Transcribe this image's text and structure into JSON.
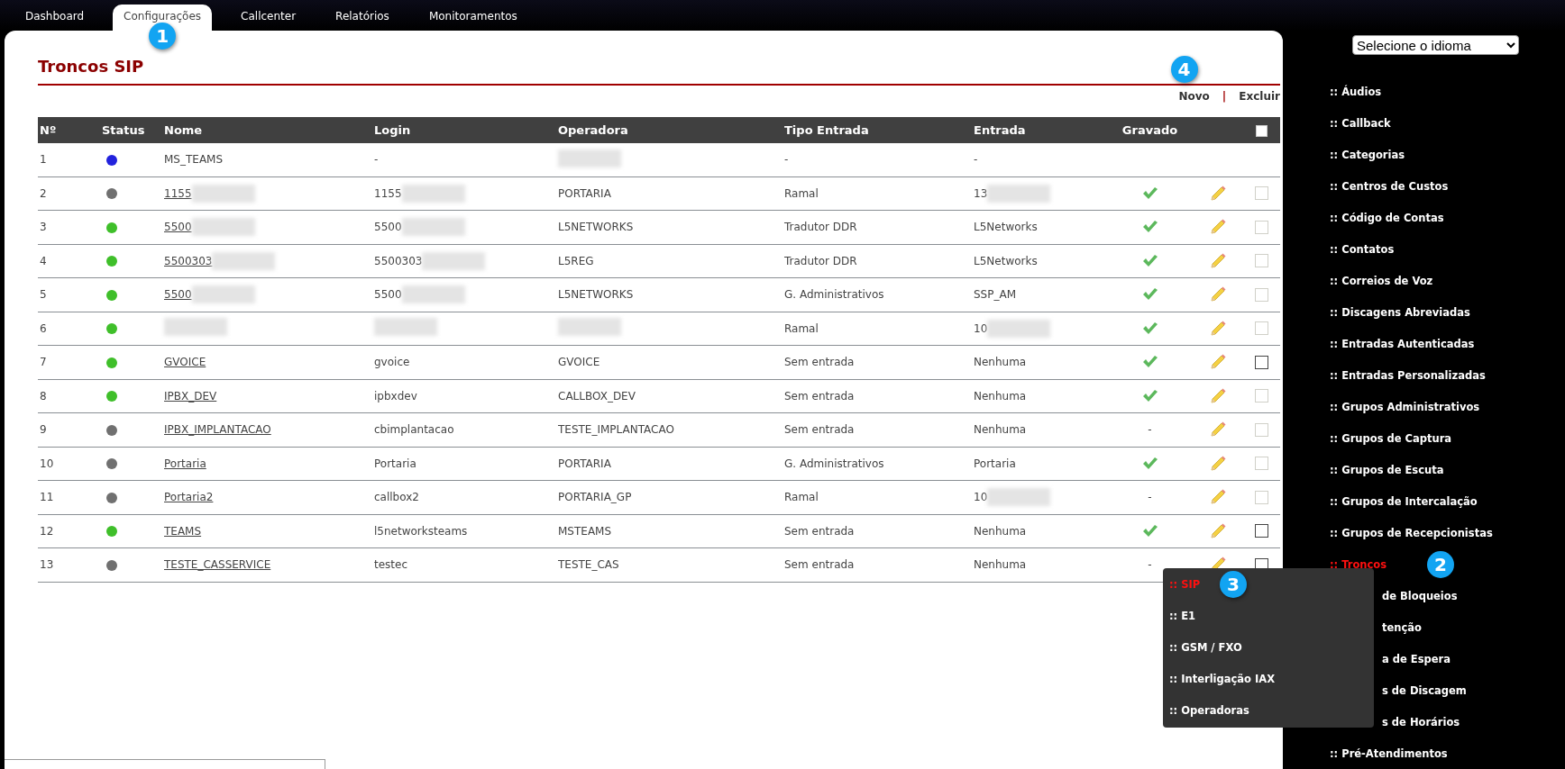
{
  "nav_tabs": [
    {
      "label": "Dashboard",
      "selected": false
    },
    {
      "label": "Configurações",
      "selected": true,
      "badge": "1"
    },
    {
      "label": "Callcenter",
      "selected": false
    },
    {
      "label": "Relatórios",
      "selected": false
    },
    {
      "label": "Monitoramentos",
      "selected": false
    }
  ],
  "page_title": "Troncos SIP",
  "actions": [
    {
      "label": "Novo",
      "badge": "4"
    },
    {
      "label": "Excluir"
    }
  ],
  "action_separator": "|",
  "table": {
    "columns": [
      "Nº",
      "Status",
      "Nome",
      "Login",
      "Operadora",
      "Tipo Entrada",
      "Entrada",
      "Gravado"
    ],
    "select_all": {
      "checked": false
    },
    "rows": [
      {
        "n": "1",
        "color": "#2222dd",
        "nome": {
          "text": "MS_TEAMS",
          "link": false
        },
        "login": {
          "text": "-"
        },
        "operadora": {
          "blurred": true
        },
        "tipo": "-",
        "entrada": {
          "text": "-"
        },
        "saved": {
          "kind": "none"
        },
        "editable": false
      },
      {
        "n": "2",
        "color": "#707070",
        "nome": {
          "text": "1155",
          "link": true,
          "blurred": true
        },
        "login": {
          "text": "1155",
          "blurred": true
        },
        "operadora": {
          "text": "PORTARIA"
        },
        "tipo": "Ramal",
        "entrada": {
          "text": "13",
          "blurred": true
        },
        "saved": {
          "kind": "check"
        },
        "editable": true,
        "checkbox": {
          "checked": false,
          "disabled": true
        }
      },
      {
        "n": "3",
        "color": "#3fbf2a",
        "nome": {
          "text": "5500",
          "link": true,
          "blurred": true
        },
        "login": {
          "text": "5500",
          "blurred": true
        },
        "operadora": {
          "text": "L5NETWORKS"
        },
        "tipo": "Tradutor DDR",
        "entrada": {
          "text": "L5Networks"
        },
        "saved": {
          "kind": "check"
        },
        "editable": true,
        "checkbox": {
          "checked": false,
          "disabled": true
        }
      },
      {
        "n": "4",
        "color": "#3fbf2a",
        "nome": {
          "text": "5500303",
          "link": true,
          "blurred": true
        },
        "login": {
          "text": "5500303",
          "blurred": true
        },
        "operadora": {
          "text": "L5REG"
        },
        "tipo": "Tradutor DDR",
        "entrada": {
          "text": "L5Networks"
        },
        "saved": {
          "kind": "check"
        },
        "editable": true,
        "checkbox": {
          "checked": false,
          "disabled": true
        }
      },
      {
        "n": "5",
        "color": "#3fbf2a",
        "nome": {
          "text": "5500",
          "link": true,
          "blurred": true
        },
        "login": {
          "text": "5500",
          "blurred": true
        },
        "operadora": {
          "text": "L5NETWORKS"
        },
        "tipo": "G. Administrativos",
        "entrada": {
          "text": "SSP_AM"
        },
        "saved": {
          "kind": "check"
        },
        "editable": true,
        "checkbox": {
          "checked": false,
          "disabled": true
        }
      },
      {
        "n": "6",
        "color": "#3fbf2a",
        "nome": {
          "blurred": true
        },
        "login": {
          "blurred": true
        },
        "operadora": {
          "blurred": true
        },
        "tipo": "Ramal",
        "entrada": {
          "text": "10",
          "blurred": true
        },
        "saved": {
          "kind": "check"
        },
        "editable": true,
        "checkbox": {
          "checked": false,
          "disabled": true
        }
      },
      {
        "n": "7",
        "color": "#3fbf2a",
        "nome": {
          "text": "GVOICE",
          "link": true
        },
        "login": {
          "text": "gvoice"
        },
        "operadora": {
          "text": "GVOICE"
        },
        "tipo": "Sem entrada",
        "entrada": {
          "text": "Nenhuma"
        },
        "saved": {
          "kind": "check"
        },
        "editable": true,
        "checkbox": {
          "checked": false,
          "disabled": false
        }
      },
      {
        "n": "8",
        "color": "#3fbf2a",
        "nome": {
          "text": "IPBX_DEV",
          "link": true
        },
        "login": {
          "text": "ipbxdev"
        },
        "operadora": {
          "text": "CALLBOX_DEV"
        },
        "tipo": "Sem entrada",
        "entrada": {
          "text": "Nenhuma"
        },
        "saved": {
          "kind": "check"
        },
        "editable": true,
        "checkbox": {
          "checked": false,
          "disabled": true
        }
      },
      {
        "n": "9",
        "color": "#707070",
        "nome": {
          "text": "IPBX_IMPLANTACAO",
          "link": true
        },
        "login": {
          "text": "cbimplantacao"
        },
        "operadora": {
          "text": "TESTE_IMPLANTACAO"
        },
        "tipo": "Sem entrada",
        "entrada": {
          "text": "Nenhuma"
        },
        "saved": {
          "kind": "text",
          "text": "-"
        },
        "editable": true,
        "checkbox": {
          "checked": false,
          "disabled": true
        }
      },
      {
        "n": "10",
        "color": "#707070",
        "nome": {
          "text": "Portaria",
          "link": true
        },
        "login": {
          "text": "Portaria"
        },
        "operadora": {
          "text": "PORTARIA"
        },
        "tipo": "G. Administrativos",
        "entrada": {
          "text": "Portaria"
        },
        "saved": {
          "kind": "check"
        },
        "editable": true,
        "checkbox": {
          "checked": false,
          "disabled": true
        }
      },
      {
        "n": "11",
        "color": "#707070",
        "nome": {
          "text": "Portaria2",
          "link": true
        },
        "login": {
          "text": "callbox2"
        },
        "operadora": {
          "text": "PORTARIA_GP"
        },
        "tipo": "Ramal",
        "entrada": {
          "text": "10",
          "blurred": true
        },
        "saved": {
          "kind": "text",
          "text": "-"
        },
        "editable": true,
        "checkbox": {
          "checked": false,
          "disabled": true
        }
      },
      {
        "n": "12",
        "color": "#3fbf2a",
        "nome": {
          "text": "TEAMS",
          "link": true
        },
        "login": {
          "text": "l5networksteams"
        },
        "operadora": {
          "text": "MSTEAMS"
        },
        "tipo": "Sem entrada",
        "entrada": {
          "text": "Nenhuma"
        },
        "saved": {
          "kind": "check"
        },
        "editable": true,
        "checkbox": {
          "checked": false,
          "disabled": false
        }
      },
      {
        "n": "13",
        "color": "#707070",
        "nome": {
          "text": "TESTE_CASSERVICE",
          "link": true
        },
        "login": {
          "text": "testec"
        },
        "operadora": {
          "text": "TESTE_CAS"
        },
        "tipo": "Sem entrada",
        "entrada": {
          "text": "Nenhuma"
        },
        "saved": {
          "kind": "text",
          "text": "-"
        },
        "editable": true,
        "checkbox": {
          "checked": false,
          "disabled": false
        }
      }
    ]
  },
  "language_select": {
    "value": "Selecione o idioma"
  },
  "sidebar": {
    "items": [
      {
        "label": ":: Áudios",
        "selected": false
      },
      {
        "label": ":: Callback",
        "selected": false
      },
      {
        "label": ":: Categorias",
        "selected": false
      },
      {
        "label": ":: Centros de Custos",
        "selected": false
      },
      {
        "label": ":: Código de Contas",
        "selected": false
      },
      {
        "label": ":: Contatos",
        "selected": false
      },
      {
        "label": ":: Correios de Voz",
        "selected": false
      },
      {
        "label": ":: Discagens Abreviadas",
        "selected": false
      },
      {
        "label": ":: Entradas Autenticadas",
        "selected": false
      },
      {
        "label": ":: Entradas Personalizadas",
        "selected": false
      },
      {
        "label": ":: Grupos Administrativos",
        "selected": false
      },
      {
        "label": ":: Grupos de Captura",
        "selected": false
      },
      {
        "label": ":: Grupos de Escuta",
        "selected": false
      },
      {
        "label": ":: Grupos de Intercalação",
        "selected": false
      },
      {
        "label": ":: Grupos de Recepcionistas",
        "selected": false
      },
      {
        "label": ":: Troncos",
        "selected": true,
        "badge": "2",
        "expanded": true,
        "children": [
          {
            "label": ":: SIP",
            "selected": true,
            "badge": "3"
          },
          {
            "label": ":: E1",
            "selected": false
          },
          {
            "label": ":: GSM / FXO",
            "selected": false
          },
          {
            "label": ":: Interligação IAX",
            "selected": false
          },
          {
            "label": ":: Operadoras",
            "selected": false
          }
        ]
      },
      {
        "label": "de Bloqueios",
        "selected": false,
        "covered": true
      },
      {
        "label": "tenção",
        "selected": false,
        "covered": true
      },
      {
        "label": "a de Espera",
        "selected": false,
        "covered": true
      },
      {
        "label": "s de Discagem",
        "selected": false,
        "covered": true
      },
      {
        "label": "s de Horários",
        "selected": false,
        "covered": true
      },
      {
        "label": ":: Pré-Atendimentos",
        "selected": false
      }
    ]
  }
}
